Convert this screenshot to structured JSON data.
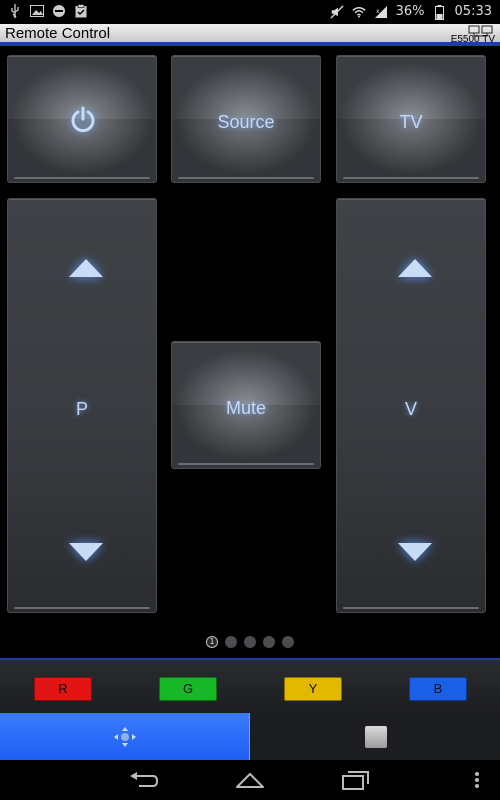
{
  "statusbar": {
    "battery": "36%",
    "time": "05:33",
    "icons": [
      "usb-icon",
      "image-icon",
      "game-icon",
      "clipboard-icon",
      "mute-icon",
      "wifi-icon",
      "signal-icon",
      "battery-icon"
    ]
  },
  "titlebar": {
    "title": "Remote Control",
    "tv_model": "E5500 TV"
  },
  "buttons": {
    "power": {
      "icon": "power-icon"
    },
    "source": {
      "label": "Source"
    },
    "tv": {
      "label": "TV"
    },
    "program": {
      "label": "P"
    },
    "mute": {
      "label": "Mute"
    },
    "volume": {
      "label": "V"
    }
  },
  "pager": {
    "active_page": "1",
    "total": 5
  },
  "colors": {
    "red": {
      "label": "R",
      "color": "#e31414"
    },
    "green": {
      "label": "G",
      "color": "#16b828"
    },
    "yellow": {
      "label": "Y",
      "color": "#e3b900"
    },
    "blue": {
      "label": "B",
      "color": "#1a5fe8"
    }
  },
  "modes": {
    "left_icon": "dpad-icon",
    "right_icon": "stop-icon"
  },
  "navbar": {
    "icons": [
      "back-icon",
      "home-icon",
      "recent-apps-icon",
      "menu-icon"
    ]
  }
}
